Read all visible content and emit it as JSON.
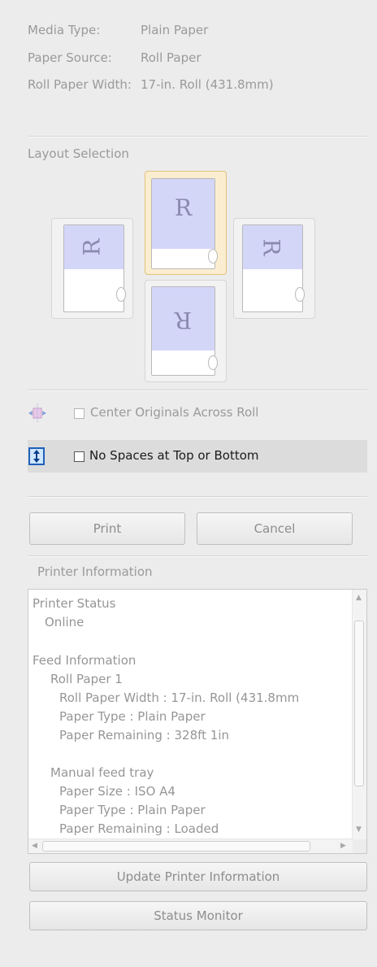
{
  "info": [
    {
      "label": "Media Type:",
      "value": "Plain Paper"
    },
    {
      "label": "Paper Source:",
      "value": "Roll Paper"
    },
    {
      "label": "Roll Paper Width:",
      "value": "17-in. Roll (431.8mm)"
    }
  ],
  "layout": {
    "heading": "Layout Selection",
    "tile_letter": "R",
    "selected": "portrait"
  },
  "options": {
    "center_label": "Center Originals Across Roll",
    "center_checked": false,
    "no_spaces_label": "No Spaces at Top or Bottom",
    "no_spaces_checked": false
  },
  "buttons": {
    "print": "Print",
    "cancel": "Cancel",
    "update": "Update Printer Information",
    "status_monitor": "Status Monitor"
  },
  "printer_info": {
    "heading": "Printer Information",
    "lines": [
      "Printer Status",
      "Online",
      "",
      "Feed Information",
      "Roll Paper 1",
      "Roll Paper Width : 17-in. Roll (431.8mm",
      "Paper Type : Plain Paper",
      "Paper Remaining : 328ft 1in",
      "",
      "Manual feed tray",
      "Paper Size : ISO A4",
      "Paper Type : Plain Paper",
      "Paper Remaining : Loaded"
    ]
  },
  "colors": {
    "selected_tile": "#fbeed0",
    "page_image": "#d4d6f8",
    "options_band": "#dcdcdc"
  }
}
